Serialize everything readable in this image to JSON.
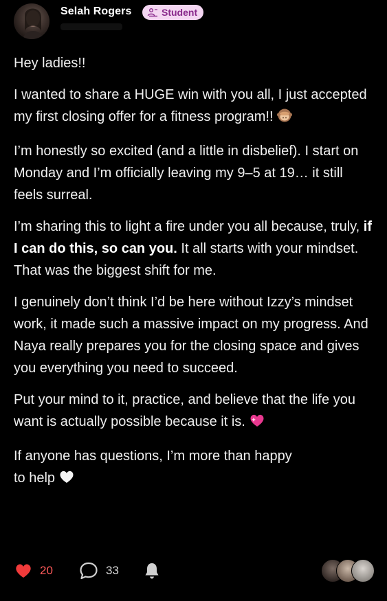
{
  "post": {
    "author": {
      "name": "Selah Rogers",
      "badge": "Student"
    },
    "paragraphs": {
      "p1": "Hey ladies!!",
      "p2": "I wanted to share a HUGE win with you all, I just accepted my first closing offer for a fitness program!!",
      "p3": "I’m honestly so excited (and a little in disbelief). I start on Monday and I’m officially leaving my 9–5 at 19… it still feels surreal.",
      "p4_before": "I’m sharing this to light a fire under you all because, truly, ",
      "p4_bold": "if I can do this, so can you.",
      "p4_after": " It all starts with your mindset. That was the biggest shift for me.",
      "p5": "I genuinely don’t think I’d be here without Izzy’s mindset work, it made such a massive impact on my progress. And Naya really prepares you for the closing space and gives you everything you need to succeed.",
      "p6": "Put your mind to it, practice, and believe that the life you want is actually possible because it is.",
      "p7_line1": "If anyone has questions, I’m more than happy",
      "p7_line2": "to help"
    },
    "emojis": [
      "see-no-evil-monkey-icon",
      "sparkling-heart-icon",
      "white-heart-icon"
    ],
    "footer": {
      "likes": "20",
      "comments": "33"
    },
    "colors": {
      "background": "#000000",
      "text": "#efefef",
      "like": "#ff4d4d",
      "badge_bg": "#f4d6f2",
      "badge_text": "#8a2a8c"
    }
  }
}
